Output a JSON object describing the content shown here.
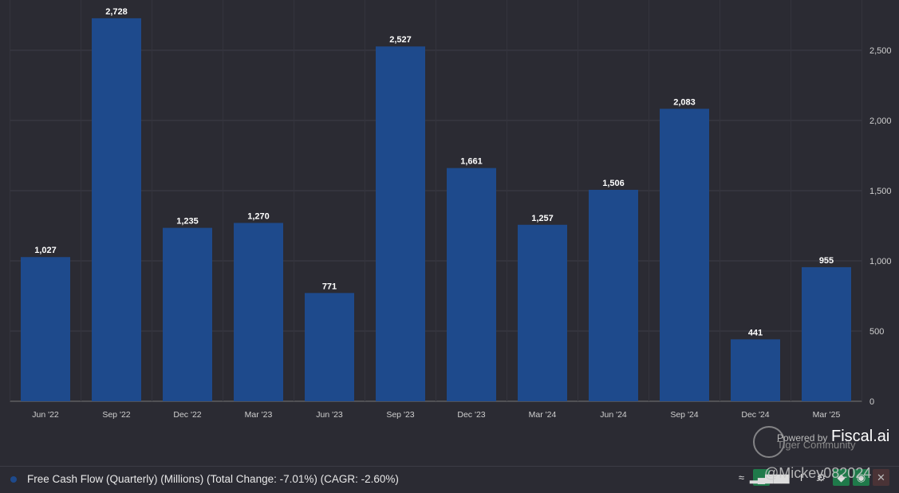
{
  "chart_data": {
    "type": "bar",
    "categories": [
      "Jun '22",
      "Sep '22",
      "Dec '22",
      "Mar '23",
      "Jun '23",
      "Sep '23",
      "Dec '23",
      "Mar '24",
      "Jun '24",
      "Sep '24",
      "Dec '24",
      "Mar '25"
    ],
    "values": [
      1027,
      2728,
      1235,
      1270,
      771,
      2527,
      1661,
      1257,
      1506,
      2083,
      441,
      955
    ],
    "value_labels": [
      "1,027",
      "2,728",
      "1,235",
      "1,270",
      "771",
      "2,527",
      "1,661",
      "1,257",
      "1,506",
      "2,083",
      "441",
      "955"
    ],
    "yticks": [
      0,
      500,
      1000,
      1500,
      2000,
      2500
    ],
    "ytick_labels": [
      "0",
      "500",
      "1,000",
      "1,500",
      "2,000",
      "2,500"
    ],
    "ylim": [
      0,
      2728
    ],
    "y_axis_side": "right",
    "grid": true,
    "bar_color": "#1e4a8c",
    "series": [
      {
        "name": "Free Cash Flow (Quarterly) (Millions) (Total Change: -7.01%) (CAGR: -2.60%)"
      }
    ],
    "legend_placement": "bottom-left"
  },
  "branding": {
    "powered_by": "Powered by",
    "brand": "Fiscal.ai",
    "community": "Tiger Community",
    "watermark": "@Mickey082024"
  },
  "toolbar": {
    "icons": [
      "line-chart-icon",
      "bar-chart-icon",
      "grouped-bar-icon",
      "cursor-icon",
      "gear-icon",
      "tag-icon",
      "eye-icon",
      "close-icon"
    ]
  }
}
